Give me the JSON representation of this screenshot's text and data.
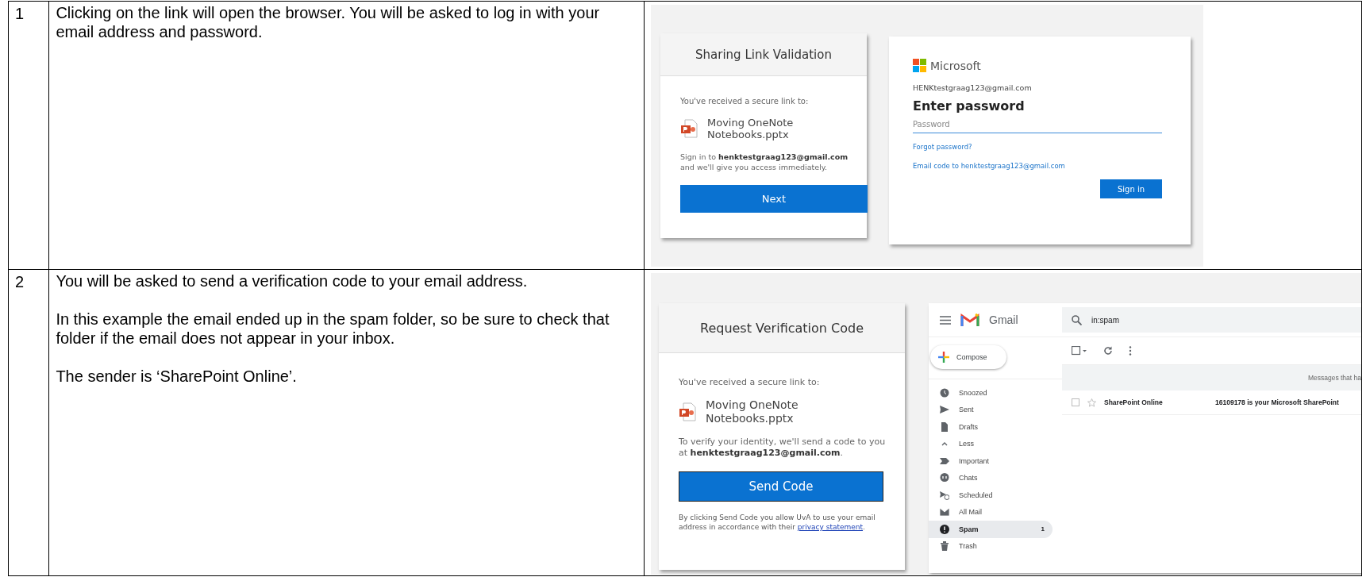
{
  "steps": [
    {
      "number": "1",
      "paragraphs": [
        "Clicking on the link will open the browser. You will be asked to log in with your email address and password."
      ]
    },
    {
      "number": "2",
      "paragraphs": [
        "You will be asked to send a verification code to your email address.",
        "In this example the email ended up in the spam folder, so be sure to check that folder if the email does not appear in your inbox.",
        "The sender is ‘SharePoint Online’."
      ]
    }
  ],
  "sharing_card": {
    "title": "Sharing Link Validation",
    "intro": "You've received a secure link to:",
    "file_name": "Moving OneNote Notebooks.pptx",
    "message": "Sign in to **henktestgraag123@gmail.com** and we'll give you access immediately.",
    "button": "Next"
  },
  "microsoft_card": {
    "brand": "Microsoft",
    "account": "HENKtestgraag123@gmail.com",
    "heading": "Enter password",
    "placeholder": "Password",
    "forgot_link": "Forgot password?",
    "email_code_link": "Email code to henktestgraag123@gmail.com",
    "button": "Sign in"
  },
  "verification_card": {
    "title": "Request Verification Code",
    "intro": "You've received a secure link to:",
    "file_name": "Moving OneNote Notebooks.pptx",
    "message": "To verify your identity, we'll send a code to you at **henktestgraag123@gmail.com**.",
    "button": "Send Code",
    "consent": "By clicking Send Code you allow UvA to use your email address in accordance with their",
    "consent_link": "privacy statement",
    "consent_end": "."
  },
  "gmail": {
    "brand": "Gmail",
    "search": "in:spam",
    "compose": "Compose",
    "folders": [
      {
        "kind": "clock",
        "label": "Snoozed",
        "selected": false
      },
      {
        "kind": "send",
        "label": "Sent",
        "selected": false
      },
      {
        "kind": "file",
        "label": "Drafts",
        "selected": false
      },
      {
        "kind": "chevron",
        "label": "Less",
        "selected": false
      },
      {
        "kind": "label",
        "label": "Important",
        "selected": false
      },
      {
        "kind": "chat",
        "label": "Chats",
        "selected": false
      },
      {
        "kind": "scheduled",
        "label": "Scheduled",
        "selected": false
      },
      {
        "kind": "mail",
        "label": "All Mail",
        "selected": false
      },
      {
        "kind": "alert",
        "label": "Spam",
        "selected": true,
        "count": "1"
      },
      {
        "kind": "trash",
        "label": "Trash",
        "selected": false
      }
    ],
    "banner": "Messages that ha",
    "messages": [
      {
        "sender": "SharePoint Online",
        "subject": "16109178 is your Microsoft SharePoint"
      }
    ]
  }
}
